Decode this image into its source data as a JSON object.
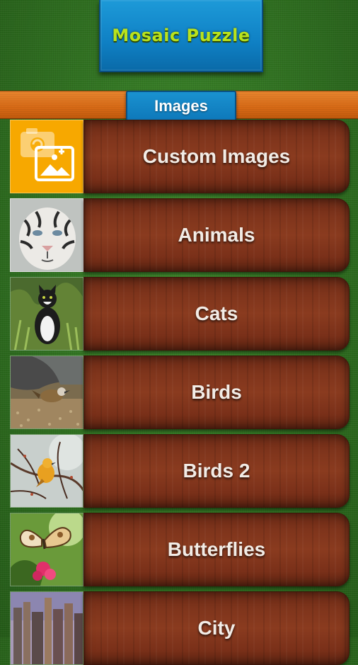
{
  "app": {
    "title": "Mosaic Puzzle"
  },
  "section": {
    "title": "Images"
  },
  "categories": [
    {
      "label": "Custom Images",
      "thumb_icon": "add-image-icon"
    },
    {
      "label": "Animals",
      "thumb_icon": "white-tiger-photo"
    },
    {
      "label": "Cats",
      "thumb_icon": "black-white-cat-photo"
    },
    {
      "label": "Birds",
      "thumb_icon": "bird-on-ground-photo"
    },
    {
      "label": "Birds 2",
      "thumb_icon": "yellow-bird-on-branch-photo"
    },
    {
      "label": "Butterflies",
      "thumb_icon": "butterfly-on-flower-photo"
    },
    {
      "label": "City",
      "thumb_icon": "city-skyline-photo"
    }
  ],
  "colors": {
    "title_text": "#b9e21d",
    "banner_blue": "#0f80c4",
    "strip_orange": "#d76a16",
    "wood": "#7a3019",
    "custom_thumb": "#f7a800"
  }
}
